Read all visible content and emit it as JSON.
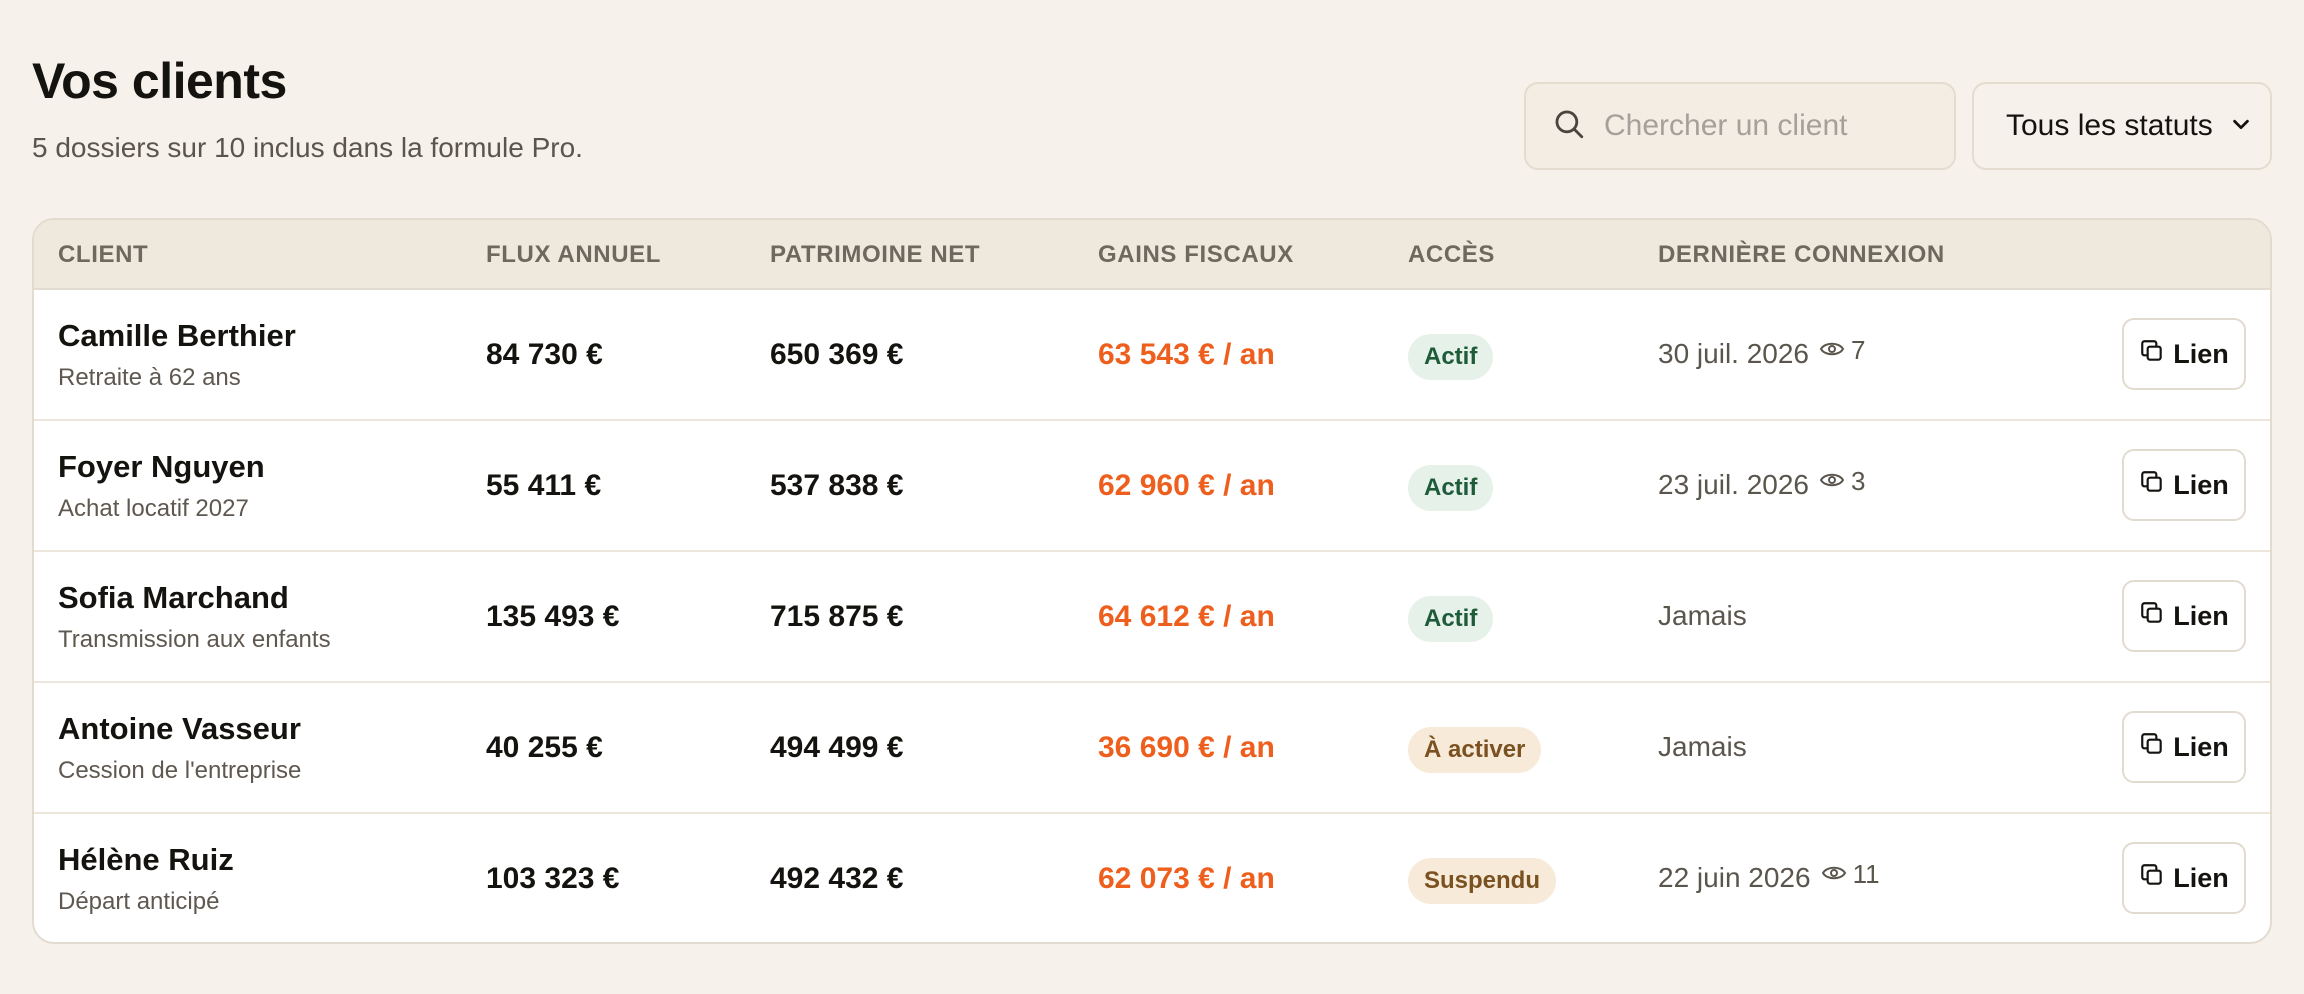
{
  "header": {
    "title": "Vos clients",
    "subtitle": "5 dossiers sur 10 inclus dans la formule Pro."
  },
  "search": {
    "placeholder": "Chercher un client",
    "value": ""
  },
  "status_filter": {
    "selected": "Tous les statuts"
  },
  "table": {
    "columns": [
      "CLIENT",
      "FLUX ANNUEL",
      "PATRIMOINE NET",
      "GAINS FISCAUX",
      "ACCÈS",
      "DERNIÈRE CONNEXION"
    ],
    "rows": [
      {
        "name": "Camille Berthier",
        "note": "Retraite à 62 ans",
        "flux": "84 730 €",
        "patrimoine": "650 369 €",
        "gains": "63 543 € / an",
        "access": "Actif",
        "last_login": "30 juil. 2026",
        "views": "7",
        "link": "Lien"
      },
      {
        "name": "Foyer Nguyen",
        "note": "Achat locatif 2027",
        "flux": "55 411 €",
        "patrimoine": "537 838 €",
        "gains": "62 960 € / an",
        "access": "Actif",
        "last_login": "23 juil. 2026",
        "views": "3",
        "link": "Lien"
      },
      {
        "name": "Sofia Marchand",
        "note": "Transmission aux enfants",
        "flux": "135 493 €",
        "patrimoine": "715 875 €",
        "gains": "64 612 € / an",
        "access": "Actif",
        "last_login": "Jamais",
        "views": null,
        "link": "Lien"
      },
      {
        "name": "Antoine Vasseur",
        "note": "Cession de l'entreprise",
        "flux": "40 255 €",
        "patrimoine": "494 499 €",
        "gains": "36 690 € / an",
        "access": "À activer",
        "last_login": "Jamais",
        "views": null,
        "link": "Lien"
      },
      {
        "name": "Hélène Ruiz",
        "note": "Départ anticipé",
        "flux": "103 323 €",
        "patrimoine": "492 432 €",
        "gains": "62 073 € / an",
        "access": "Suspendu",
        "last_login": "22 juin 2026",
        "views": "11",
        "link": "Lien"
      }
    ]
  },
  "colors": {
    "background": "#f6f1ea",
    "gain": "#ee5f1d",
    "active_badge_bg": "#e6f1e9",
    "active_badge_text": "#1e5b39",
    "pending_badge_bg": "#f8ead8",
    "pending_badge_text": "#7a5120"
  },
  "icons": {
    "search": "search-icon",
    "select_caret": "chevron-down-icon",
    "views": "eye-icon",
    "link": "copy-icon"
  }
}
